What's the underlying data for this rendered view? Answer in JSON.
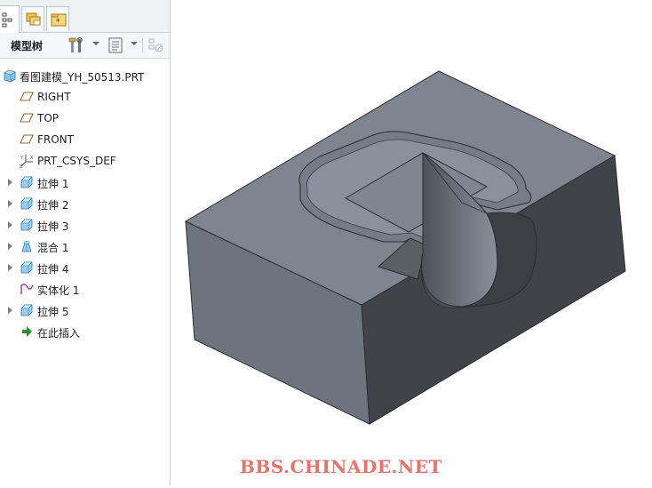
{
  "tabs": [
    {
      "name": "model-tree-tab"
    },
    {
      "name": "folder-browser-tab"
    },
    {
      "name": "favorites-tab"
    }
  ],
  "toolbar": {
    "title": "模型树"
  },
  "tree": {
    "items": [
      {
        "label": "看图建模_YH_50513.PRT",
        "icon": "part-icon",
        "expandable": false
      },
      {
        "label": "RIGHT",
        "icon": "datum-plane-icon",
        "expandable": false
      },
      {
        "label": "TOP",
        "icon": "datum-plane-icon",
        "expandable": false
      },
      {
        "label": "FRONT",
        "icon": "datum-plane-icon",
        "expandable": false
      },
      {
        "label": "PRT_CSYS_DEF",
        "icon": "coordinate-system-icon",
        "expandable": false
      },
      {
        "label": "拉伸 1",
        "icon": "extrude-icon",
        "expandable": true
      },
      {
        "label": "拉伸 2",
        "icon": "extrude-icon",
        "expandable": true
      },
      {
        "label": "拉伸 3",
        "icon": "extrude-icon",
        "expandable": true
      },
      {
        "label": "混合 1",
        "icon": "blend-icon",
        "expandable": true
      },
      {
        "label": "拉伸 4",
        "icon": "extrude-icon",
        "expandable": true
      },
      {
        "label": "实体化 1",
        "icon": "solidify-icon",
        "expandable": false
      },
      {
        "label": "拉伸 5",
        "icon": "extrude-icon",
        "expandable": true
      },
      {
        "label": "在此插入",
        "icon": "insert-arrow-icon",
        "expandable": false
      }
    ]
  },
  "viewport": {
    "watermark": "BBS.CHINADE.NET"
  },
  "colors": {
    "model_top": "#7f858e",
    "model_left": "#6e747d",
    "model_right": "#40444a",
    "watermark": "#e8736b"
  }
}
